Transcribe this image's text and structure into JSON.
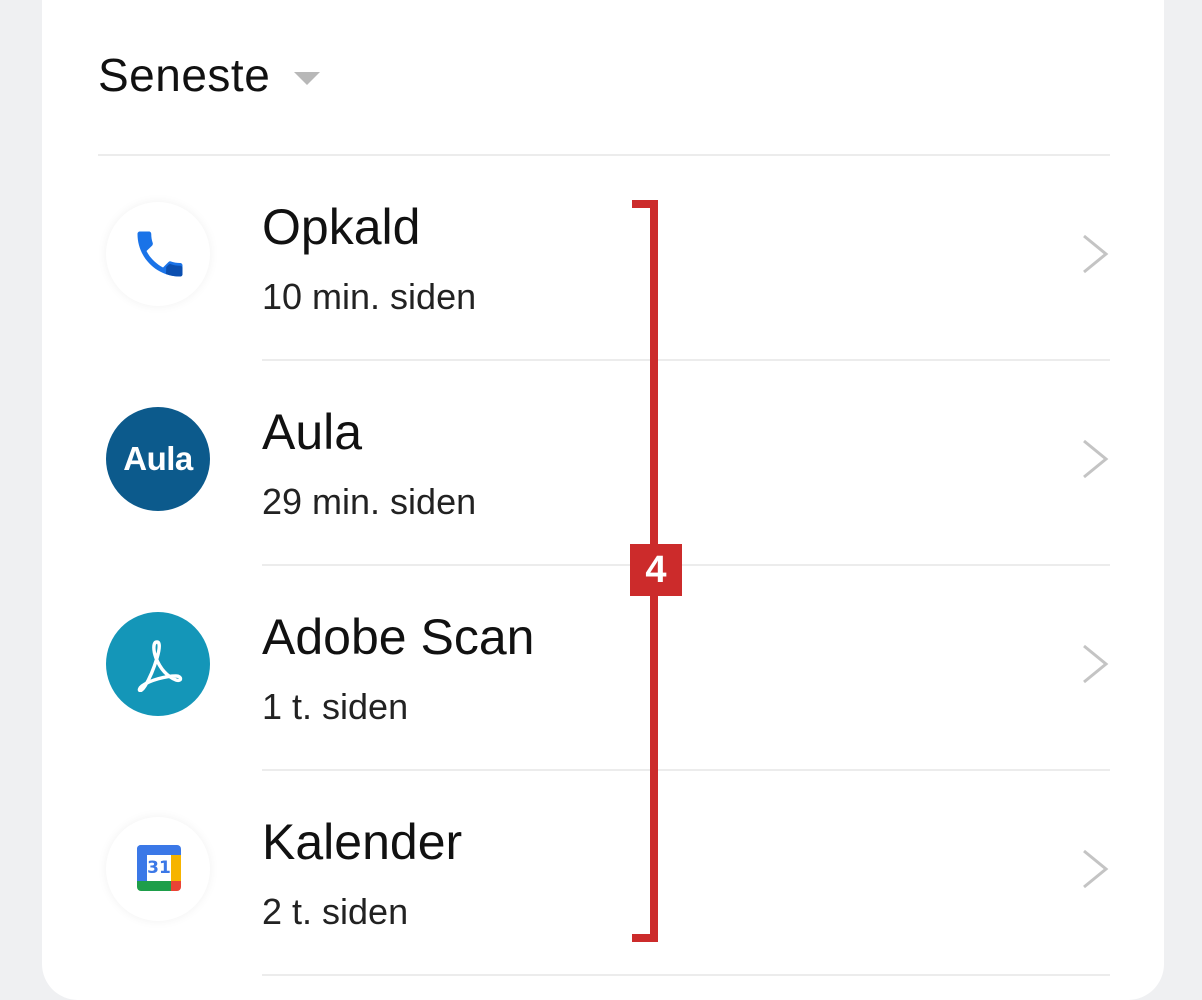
{
  "section": {
    "title": "Seneste"
  },
  "items": [
    {
      "title": "Opkald",
      "subtitle": "10 min. siden",
      "icon": "phone-icon"
    },
    {
      "title": "Aula",
      "subtitle": "29 min. siden",
      "icon": "aula-icon",
      "icon_text": "Aula"
    },
    {
      "title": "Adobe Scan",
      "subtitle": "1 t. siden",
      "icon": "adobe-scan-icon"
    },
    {
      "title": "Kalender",
      "subtitle": "2 t. siden",
      "icon": "calendar-icon",
      "icon_text": "31"
    }
  ],
  "annotation": {
    "badge": "4",
    "color": "#cc2b2b"
  },
  "colors": {
    "background": "#eff0f2",
    "card": "#ffffff",
    "aula_blue": "#0c5a8c",
    "adobe_teal": "#1496b8",
    "phone_blue": "#1a73e8"
  }
}
